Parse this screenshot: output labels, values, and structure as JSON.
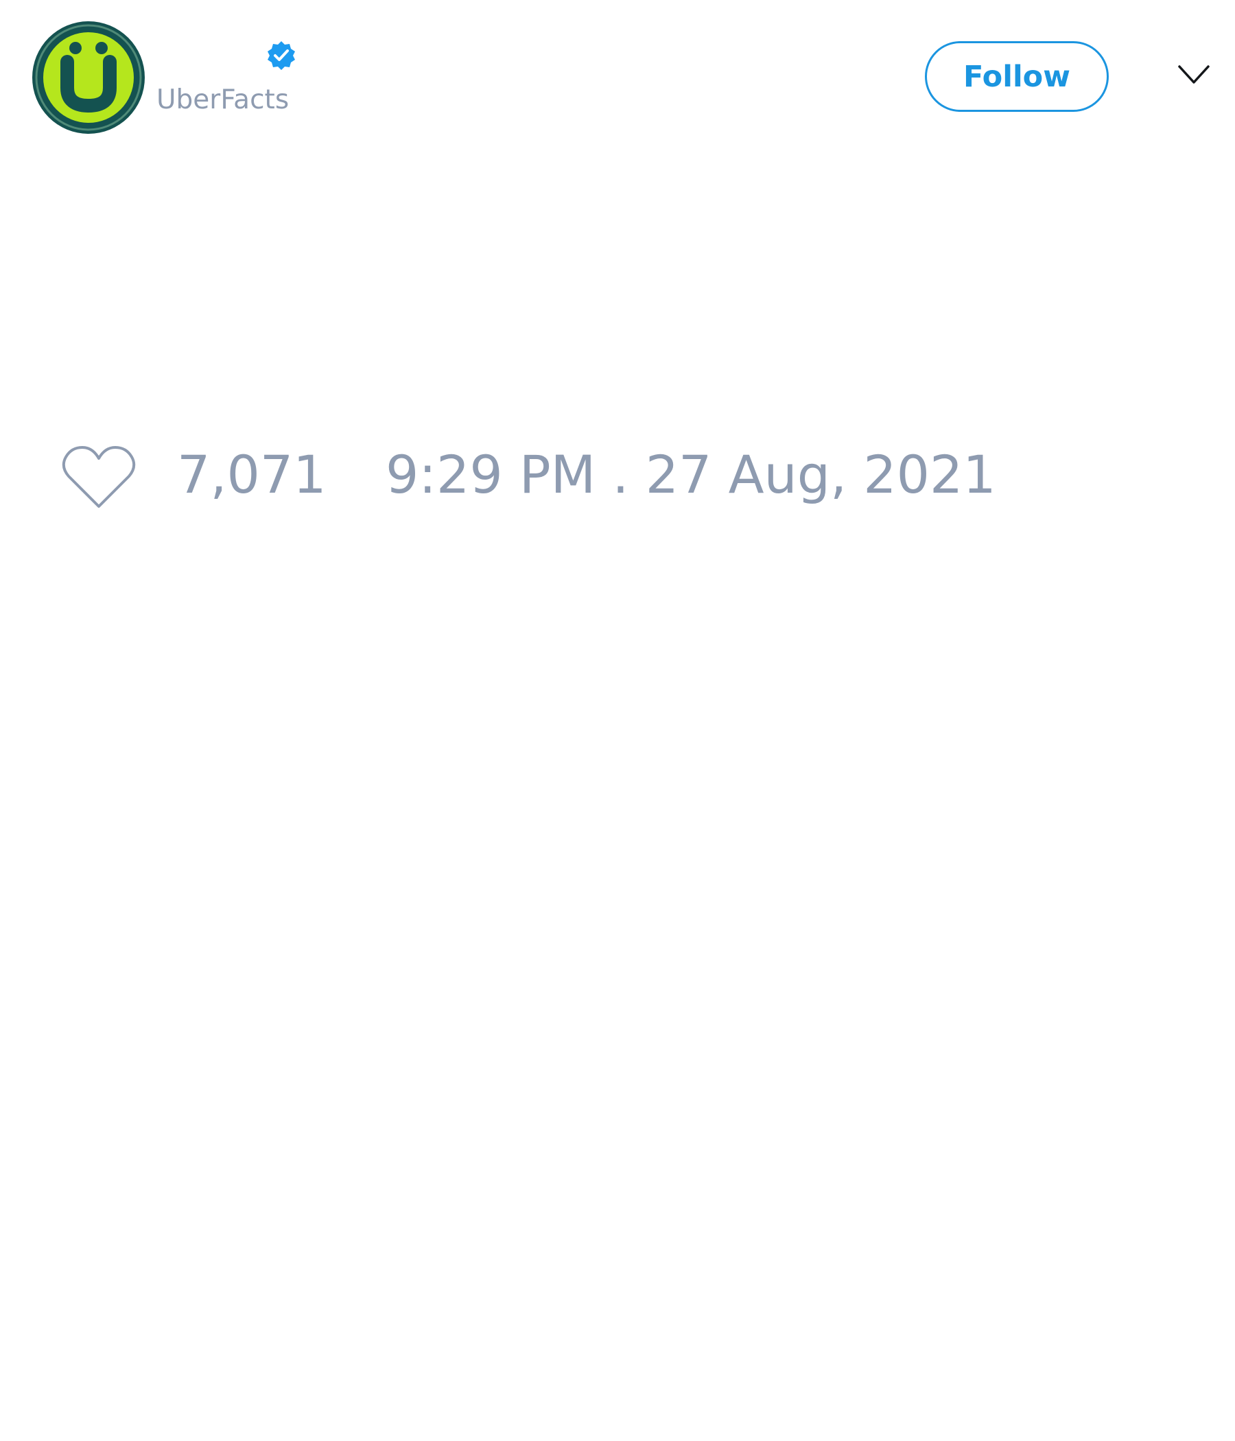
{
  "header": {
    "display_name": "",
    "handle": "UberFacts",
    "verified": true,
    "follow_label": "Follow",
    "avatar_icon": "uberfacts-logo-icon",
    "menu_icon": "chevron-down-icon"
  },
  "stats": {
    "like_icon": "heart-icon",
    "like_count": "7,071",
    "timestamp": "9:29 PM . 27 Aug, 2021"
  },
  "colors": {
    "accent": "#1b95e0",
    "muted_text": "#8e9bb0",
    "avatar_dark": "#145250",
    "avatar_lime": "#b5e61d"
  }
}
